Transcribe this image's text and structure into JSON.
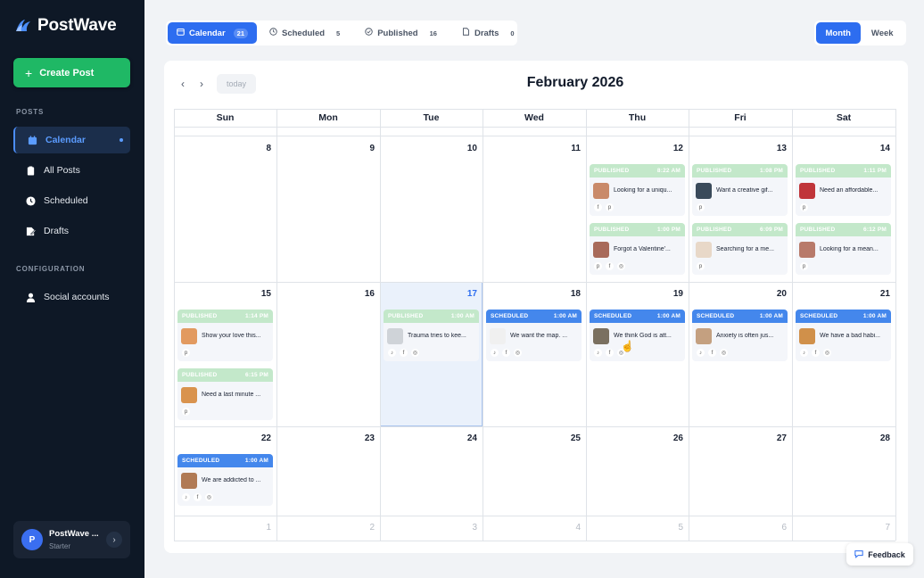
{
  "app": {
    "name": "PostWave"
  },
  "sidebar": {
    "create_label": "Create Post",
    "posts_section": "POSTS",
    "config_section": "CONFIGURATION",
    "items": [
      {
        "label": "Calendar",
        "icon": "calendar-icon",
        "active": true
      },
      {
        "label": "All Posts",
        "icon": "clipboard-icon"
      },
      {
        "label": "Scheduled",
        "icon": "clock-icon"
      },
      {
        "label": "Drafts",
        "icon": "edit-icon"
      }
    ],
    "config_items": [
      {
        "label": "Social accounts",
        "icon": "user-icon"
      }
    ],
    "user": {
      "initial": "P",
      "name": "PostWave ...",
      "plan": "Starter"
    }
  },
  "tabs": [
    {
      "label": "Calendar",
      "count": "21",
      "active": true,
      "icon": "calendar-icon"
    },
    {
      "label": "Scheduled",
      "count": "5",
      "icon": "clock-icon"
    },
    {
      "label": "Published",
      "count": "16",
      "icon": "check-circle-icon"
    },
    {
      "label": "Drafts",
      "count": "0",
      "icon": "file-icon"
    }
  ],
  "view_toggle": {
    "month": "Month",
    "week": "Week",
    "active": "month"
  },
  "calendar": {
    "title": "February 2026",
    "today_label": "today",
    "weekdays": [
      "Sun",
      "Mon",
      "Tue",
      "Wed",
      "Thu",
      "Fri",
      "Sat"
    ],
    "weeks": [
      [
        "8",
        "9",
        "10",
        "11",
        "12",
        "13",
        "14"
      ],
      [
        "15",
        "16",
        "17",
        "18",
        "19",
        "20",
        "21"
      ],
      [
        "22",
        "23",
        "24",
        "25",
        "26",
        "27",
        "28"
      ],
      [
        "1",
        "2",
        "3",
        "4",
        "5",
        "6",
        "7"
      ]
    ],
    "today": "17"
  },
  "posts": [
    {
      "week": 0,
      "day": 4,
      "slot": 0,
      "status": "PUBLISHED",
      "time": "8:22 AM",
      "text": "Looking for a uniqu...",
      "icons": [
        "facebook",
        "pinterest"
      ],
      "thumb": "#c98a6a"
    },
    {
      "week": 0,
      "day": 4,
      "slot": 1,
      "status": "PUBLISHED",
      "time": "1:00 PM",
      "text": "Forgot a Valentine'...",
      "icons": [
        "pinterest",
        "facebook",
        "instagram"
      ],
      "thumb": "#a86a5a"
    },
    {
      "week": 0,
      "day": 5,
      "slot": 0,
      "status": "PUBLISHED",
      "time": "1:08 PM",
      "text": "Want a creative gif...",
      "icons": [
        "pinterest"
      ],
      "thumb": "#3a4a5a"
    },
    {
      "week": 0,
      "day": 5,
      "slot": 1,
      "status": "PUBLISHED",
      "time": "6:09 PM",
      "text": "Searching for a me...",
      "icons": [
        "pinterest"
      ],
      "thumb": "#e8d8c8"
    },
    {
      "week": 0,
      "day": 6,
      "slot": 0,
      "status": "PUBLISHED",
      "time": "1:11 PM",
      "text": "Need an affordable...",
      "icons": [
        "pinterest"
      ],
      "thumb": "#c0353a"
    },
    {
      "week": 0,
      "day": 6,
      "slot": 1,
      "status": "PUBLISHED",
      "time": "6:12 PM",
      "text": "Looking for a mean...",
      "icons": [
        "pinterest"
      ],
      "thumb": "#b87a6a"
    },
    {
      "week": 1,
      "day": 0,
      "slot": 0,
      "status": "PUBLISHED",
      "time": "1:14 PM",
      "text": "Show your love this...",
      "icons": [
        "pinterest"
      ],
      "thumb": "#e29a60"
    },
    {
      "week": 1,
      "day": 0,
      "slot": 1,
      "status": "PUBLISHED",
      "time": "6:15 PM",
      "text": "Need a last minute ...",
      "icons": [
        "pinterest"
      ],
      "thumb": "#d9934e"
    },
    {
      "week": 1,
      "day": 2,
      "slot": 0,
      "status": "PUBLISHED",
      "time": "1:00 AM",
      "text": "Trauma tries to kee...",
      "icons": [
        "tiktok",
        "facebook",
        "instagram"
      ],
      "thumb": "#cfd3d8"
    },
    {
      "week": 1,
      "day": 3,
      "slot": 0,
      "status": "SCHEDULED",
      "time": "1:00 AM",
      "text": "We want the map. ...",
      "icons": [
        "tiktok",
        "facebook",
        "instagram"
      ],
      "thumb": "#f0f0f0"
    },
    {
      "week": 1,
      "day": 4,
      "slot": 0,
      "status": "SCHEDULED",
      "time": "1:00 AM",
      "text": "We think God is att...",
      "icons": [
        "tiktok",
        "facebook",
        "instagram"
      ],
      "thumb": "#7a7060"
    },
    {
      "week": 1,
      "day": 5,
      "slot": 0,
      "status": "SCHEDULED",
      "time": "1:00 AM",
      "text": "Anxiety is often jus...",
      "icons": [
        "tiktok",
        "facebook",
        "instagram"
      ],
      "thumb": "#c4a080"
    },
    {
      "week": 1,
      "day": 6,
      "slot": 0,
      "status": "SCHEDULED",
      "time": "1:00 AM",
      "text": "We have a bad habi...",
      "icons": [
        "tiktok",
        "facebook",
        "instagram"
      ],
      "thumb": "#d0904a"
    },
    {
      "week": 2,
      "day": 0,
      "slot": 0,
      "status": "SCHEDULED",
      "time": "1:00 AM",
      "text": "We are addicted to ...",
      "icons": [
        "tiktok",
        "facebook",
        "instagram"
      ],
      "thumb": "#b07a55"
    }
  ],
  "feedback": {
    "label": "Feedback"
  },
  "colors": {
    "accent": "#2d6df0",
    "sidebar_bg": "#0e1826",
    "create": "#1fb865",
    "published": "#c3e8ca",
    "scheduled": "#4487ec"
  }
}
